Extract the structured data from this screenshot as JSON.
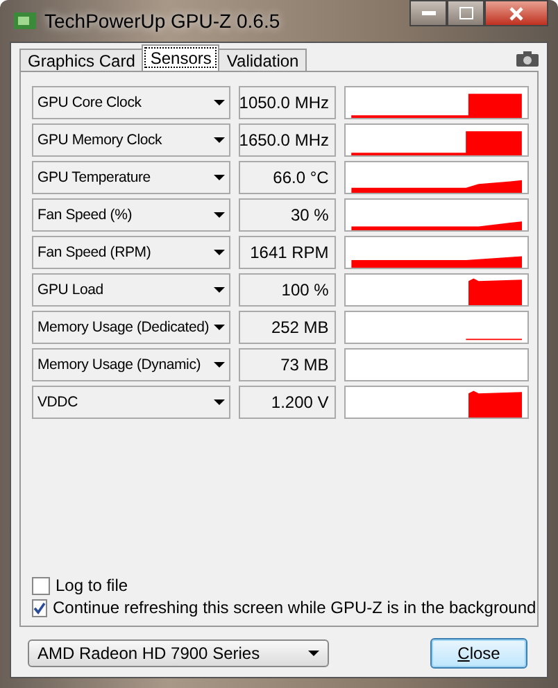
{
  "window": {
    "title": "TechPowerUp GPU-Z 0.6.5"
  },
  "tabs": [
    {
      "label": "Graphics Card",
      "selected": false
    },
    {
      "label": "Sensors",
      "selected": true
    },
    {
      "label": "Validation",
      "selected": false
    }
  ],
  "sensors": [
    {
      "name": "GPU Core Clock",
      "value": "1050.0 MHz",
      "kind": "step"
    },
    {
      "name": "GPU Memory Clock",
      "value": "1650.0 MHz",
      "kind": "jump"
    },
    {
      "name": "GPU Temperature",
      "value": "66.0 °C",
      "kind": "ramp"
    },
    {
      "name": "Fan Speed (%)",
      "value": "30 %",
      "kind": "rise"
    },
    {
      "name": "Fan Speed (RPM)",
      "value": "1641 RPM",
      "kind": "thick"
    },
    {
      "name": "GPU Load",
      "value": "100 %",
      "kind": "block"
    },
    {
      "name": "Memory Usage (Dedicated)",
      "value": "252 MB",
      "kind": "thin"
    },
    {
      "name": "Memory Usage (Dynamic)",
      "value": "73 MB",
      "kind": "empty"
    },
    {
      "name": "VDDC",
      "value": "1.200 V",
      "kind": "block"
    }
  ],
  "options": [
    {
      "label": "Log to file",
      "checked": false
    },
    {
      "label": "Continue refreshing this screen while GPU-Z is in the background",
      "checked": true
    }
  ],
  "device": {
    "value": "AMD Radeon HD 7900 Series"
  },
  "close_button": {
    "label": "Close"
  }
}
